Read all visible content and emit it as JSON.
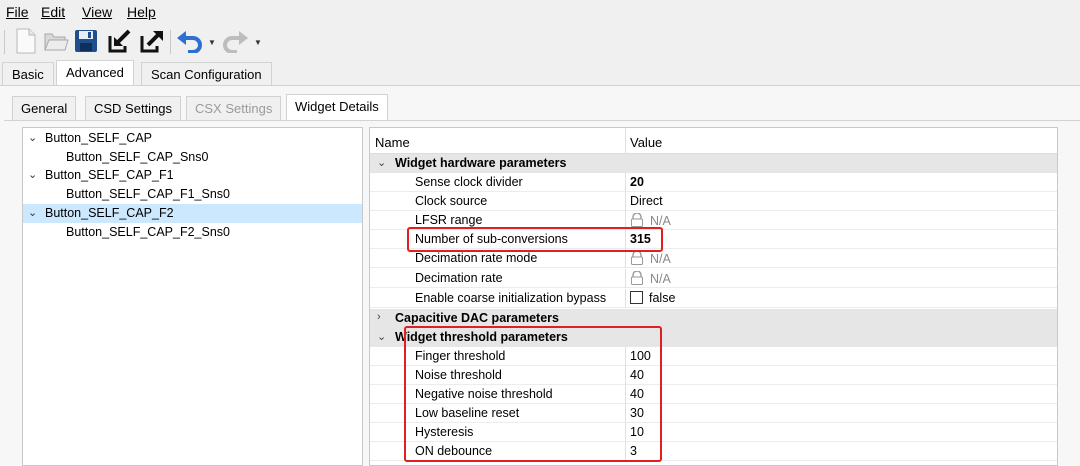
{
  "menu": {
    "file": "File",
    "edit": "Edit",
    "view": "View",
    "help": "Help"
  },
  "toolbar": {
    "icons": [
      "new-file-icon",
      "open-folder-icon",
      "save-icon",
      "import-icon",
      "export-icon",
      "undo-icon",
      "redo-icon"
    ]
  },
  "main_tabs": [
    "Basic",
    "Advanced",
    "Scan Configuration"
  ],
  "sub_tabs": [
    "General",
    "CSD Settings",
    "CSX Settings",
    "Widget Details"
  ],
  "tree": {
    "items": [
      {
        "label": "Button_SELF_CAP"
      },
      {
        "label": "Button_SELF_CAP_Sns0"
      },
      {
        "label": "Button_SELF_CAP_F1"
      },
      {
        "label": "Button_SELF_CAP_F1_Sns0"
      },
      {
        "label": "Button_SELF_CAP_F2"
      },
      {
        "label": "Button_SELF_CAP_F2_Sns0"
      }
    ]
  },
  "grid": {
    "header_name": "Name",
    "header_value": "Value",
    "categories": {
      "hw": "Widget hardware parameters",
      "cdac": "Capacitive DAC parameters",
      "thr": "Widget threshold parameters"
    },
    "rows": {
      "sense_clock_divider": {
        "name": "Sense clock divider",
        "value": "20"
      },
      "clock_source": {
        "name": "Clock source",
        "value": "Direct"
      },
      "lfsr_range": {
        "name": "LFSR range",
        "value": "N/A"
      },
      "num_sub_conversions": {
        "name": "Number of sub-conversions",
        "value": "315"
      },
      "decimation_rate_mode": {
        "name": "Decimation rate mode",
        "value": "N/A"
      },
      "decimation_rate": {
        "name": "Decimation rate",
        "value": "N/A"
      },
      "coarse_init_bypass": {
        "name": "Enable coarse initialization bypass",
        "value": "false"
      },
      "finger_threshold": {
        "name": "Finger threshold",
        "value": "100"
      },
      "noise_threshold": {
        "name": "Noise threshold",
        "value": "40"
      },
      "negative_noise_threshold": {
        "name": "Negative noise threshold",
        "value": "40"
      },
      "low_baseline_reset": {
        "name": "Low baseline reset",
        "value": "30"
      },
      "hysteresis": {
        "name": "Hysteresis",
        "value": "10"
      },
      "on_debounce": {
        "name": "ON debounce",
        "value": "3"
      }
    }
  },
  "colors": {
    "highlight": "#e02020",
    "selection": "#cce8ff",
    "category_bg": "#e6e6e6"
  }
}
